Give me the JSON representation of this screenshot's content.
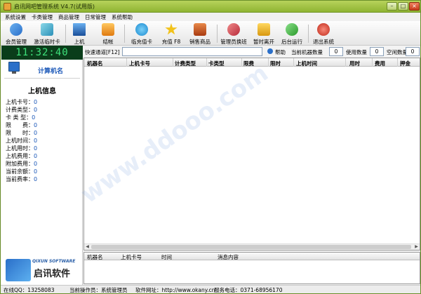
{
  "window": {
    "title": "启讯网吧管理系统 V4.7(试用版)"
  },
  "menu": [
    "系统设置",
    "卡类管理",
    "商品管理",
    "日常管理",
    "系统帮助"
  ],
  "toolbar": [
    {
      "label": "会员管理",
      "icon": "members-icon",
      "color": "#4a8fd8"
    },
    {
      "label": "激活临时卡",
      "icon": "temp-card-icon",
      "color": "#3aa0c0"
    },
    {
      "label": "上机",
      "icon": "computer-on-icon",
      "color": "#2a6fc9"
    },
    {
      "label": "结帐",
      "icon": "checkout-icon",
      "color": "#f0a030"
    },
    {
      "label": "临充值卡",
      "icon": "skype-recharge-icon",
      "color": "#2aa8e8"
    },
    {
      "label": "充值 F8",
      "icon": "star-recharge-icon",
      "color": "#f2c21a"
    },
    {
      "label": "销售商品",
      "icon": "cart-icon",
      "color": "#c84a1a"
    },
    {
      "label": "管理员换班",
      "icon": "admin-shift-icon",
      "color": "#d84a5a"
    },
    {
      "label": "暂时离开",
      "icon": "lock-icon",
      "color": "#f2b21a"
    },
    {
      "label": "后台运行",
      "icon": "background-run-icon",
      "color": "#3ab83a"
    },
    {
      "label": "退出系统",
      "icon": "exit-icon",
      "color": "#d83a3a"
    }
  ],
  "clock": "11:32:40",
  "pc_name": "计算机名",
  "info": {
    "title": "上机信息",
    "rows": [
      {
        "label": "上机卡号：",
        "value": "0"
      },
      {
        "label": "计费类型：",
        "value": "0"
      },
      {
        "label": "卡 类 型：",
        "value": "0"
      },
      {
        "label": "限　　费：",
        "value": "0"
      },
      {
        "label": "限　　时：",
        "value": "0"
      },
      {
        "label": "上机时间：",
        "value": "0"
      },
      {
        "label": "上机用时：",
        "value": "0"
      },
      {
        "label": "上机费用：",
        "value": "0"
      },
      {
        "label": "附加费用：",
        "value": "0"
      },
      {
        "label": "当前余额：",
        "value": "0"
      },
      {
        "label": "当前费率：",
        "value": "0"
      }
    ]
  },
  "logo": {
    "en": "QIXUN SOFTWARE",
    "cn": "启讯软件"
  },
  "quickbar": {
    "channel_label": "快速通道[F12]",
    "channel_value": "",
    "help_label": "帮助",
    "machines_label": "当前机器数量",
    "machines_value": "0",
    "used_label": "使用数量",
    "used_value": "0",
    "idle_label": "空闲数量",
    "idle_value": "0"
  },
  "grid": {
    "columns": [
      "机器名",
      "上机卡号",
      "计费类型",
      "卡类型",
      "限费",
      "限时",
      "上机时间",
      "用时",
      "费用",
      "押金"
    ]
  },
  "messages": {
    "columns": [
      "机器名",
      "上机卡号",
      "时间",
      "消息内容"
    ]
  },
  "status": {
    "qq": "在线QQ：13258083",
    "operator": "当前操作员：系统管理员",
    "website": "软件网址：http://www.okany.cn",
    "phone": "服务电话：0371-68956170"
  },
  "watermark": "www.ddooo.com"
}
